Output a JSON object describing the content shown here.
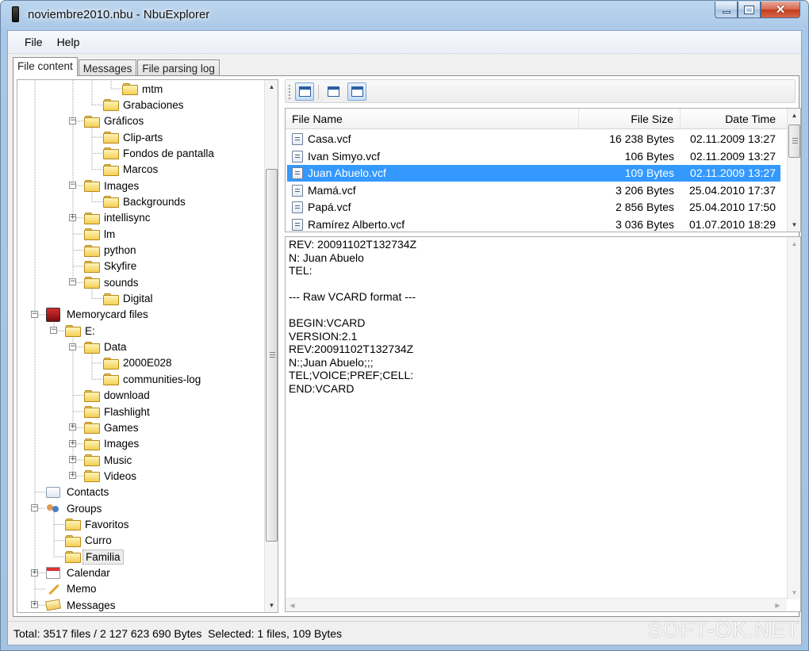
{
  "window": {
    "title": "noviembre2010.nbu - NbuExplorer"
  },
  "menu": [
    "File",
    "Help"
  ],
  "tabs": [
    "File content",
    "Messages",
    "File parsing log"
  ],
  "tree": [
    {
      "label": "mtm",
      "icon": "folder-icon"
    },
    {
      "label": "Grabaciones",
      "icon": "folder-icon"
    },
    {
      "label": "Gráficos",
      "icon": "folder-icon"
    },
    {
      "label": "Clip-arts",
      "icon": "folder-icon"
    },
    {
      "label": "Fondos de pantalla",
      "icon": "folder-icon"
    },
    {
      "label": "Marcos",
      "icon": "folder-icon"
    },
    {
      "label": "Images",
      "icon": "folder-icon"
    },
    {
      "label": "Backgrounds",
      "icon": "folder-icon"
    },
    {
      "label": "intellisync",
      "icon": "folder-icon"
    },
    {
      "label": "lm",
      "icon": "folder-icon"
    },
    {
      "label": "python",
      "icon": "folder-icon"
    },
    {
      "label": "Skyfire",
      "icon": "folder-icon"
    },
    {
      "label": "sounds",
      "icon": "folder-icon"
    },
    {
      "label": "Digital",
      "icon": "folder-icon"
    },
    {
      "label": "Memorycard files",
      "icon": "memory-card-icon"
    },
    {
      "label": "E:",
      "icon": "folder-icon"
    },
    {
      "label": "Data",
      "icon": "folder-icon"
    },
    {
      "label": "2000E028",
      "icon": "folder-icon"
    },
    {
      "label": "communities-log",
      "icon": "folder-icon"
    },
    {
      "label": "download",
      "icon": "folder-icon"
    },
    {
      "label": "Flashlight",
      "icon": "folder-icon"
    },
    {
      "label": "Games",
      "icon": "folder-icon"
    },
    {
      "label": "Images",
      "icon": "folder-icon"
    },
    {
      "label": "Music",
      "icon": "folder-icon"
    },
    {
      "label": "Videos",
      "icon": "folder-icon"
    },
    {
      "label": "Contacts",
      "icon": "contacts-icon"
    },
    {
      "label": "Groups",
      "icon": "groups-icon"
    },
    {
      "label": "Favoritos",
      "icon": "folder-icon"
    },
    {
      "label": "Curro",
      "icon": "folder-icon"
    },
    {
      "label": "Familia",
      "icon": "folder-icon"
    },
    {
      "label": "Calendar",
      "icon": "calendar-icon"
    },
    {
      "label": "Memo",
      "icon": "memo-icon"
    },
    {
      "label": "Messages",
      "icon": "messages-icon"
    }
  ],
  "file_list": {
    "columns": [
      "File Name",
      "File Size",
      "Date Time"
    ],
    "rows": [
      {
        "name": "Casa.vcf",
        "size": "16 238 Bytes",
        "date": "02.11.2009 13:27"
      },
      {
        "name": "Ivan Simyo.vcf",
        "size": "106 Bytes",
        "date": "02.11.2009 13:27"
      },
      {
        "name": "Juan Abuelo.vcf",
        "size": "109 Bytes",
        "date": "02.11.2009 13:27"
      },
      {
        "name": "Mamá.vcf",
        "size": "3 206 Bytes",
        "date": "25.04.2010 17:37"
      },
      {
        "name": "Papá.vcf",
        "size": "2 856 Bytes",
        "date": "25.04.2010 17:50"
      },
      {
        "name": "Ramírez Alberto.vcf",
        "size": "3 036 Bytes",
        "date": "01.07.2010 18:29"
      }
    ],
    "selected_row": 2
  },
  "detail": [
    "REV: 20091102T132734Z",
    "N: Juan Abuelo",
    "TEL:",
    "",
    "--- Raw VCARD format ---",
    "",
    "BEGIN:VCARD",
    "VERSION:2.1",
    "REV:20091102T132734Z",
    "N:;Juan Abuelo;;;",
    "TEL;VOICE;PREF;CELL:",
    "END:VCARD"
  ],
  "status": "Total: 3517 files / 2 127 623 690 Bytes  Selected: 1 files, 109 Bytes",
  "watermark": "SOFT-OK.NET",
  "colors": {
    "selection": "#3399ff",
    "folder": "#f4cf55"
  }
}
